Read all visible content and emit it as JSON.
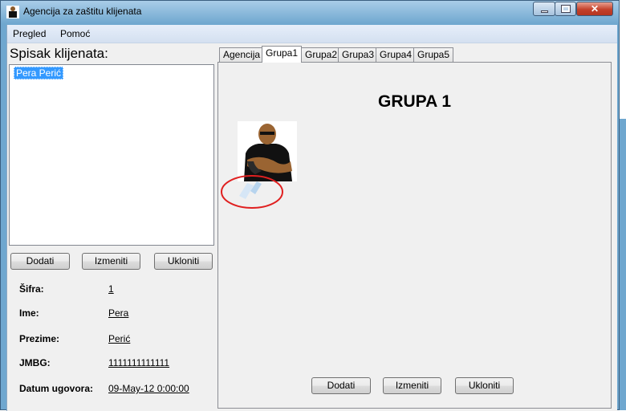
{
  "window": {
    "title": "Agencija za zaštitu klijenata",
    "controls": [
      "minimize",
      "maximize",
      "close"
    ]
  },
  "menu": [
    "Pregled",
    "Pomoć"
  ],
  "left": {
    "title": "Spisak klijenata:",
    "list": [
      "Pera Perić"
    ],
    "buttons": [
      "Dodati",
      "Izmeniti",
      "Ukloniti"
    ],
    "fields": [
      {
        "label": "Šifra:",
        "value": "1"
      },
      {
        "label": "Ime:",
        "value": "Pera"
      },
      {
        "label": "Prezime:",
        "value": "Perić"
      },
      {
        "label": "JMBG:",
        "value": "1111111111111"
      },
      {
        "label": "Datum ugovora:",
        "value": "09-May-12 0:00:00"
      }
    ]
  },
  "tabs": [
    "Agencija",
    "Grupa1",
    "Grupa2",
    "Grupa3",
    "Grupa4",
    "Grupa5"
  ],
  "active_tab": "Grupa1",
  "panel": {
    "heading": "GRUPA 1",
    "buttons": [
      "Dodati",
      "Izmeniti",
      "Ukloniti"
    ]
  },
  "colors": {
    "selection": "#3399ff",
    "titlebar": "#6fa7cf",
    "annotation_circle": "#e02020"
  }
}
